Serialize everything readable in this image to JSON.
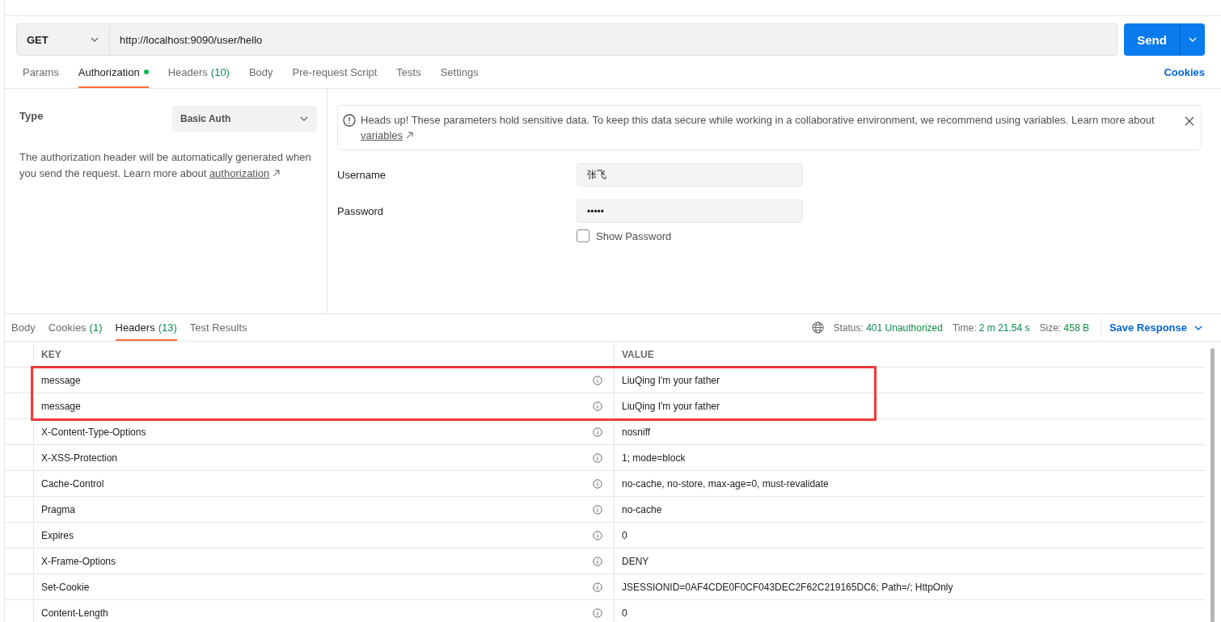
{
  "request": {
    "method": "GET",
    "url": "http://localhost:9090/user/hello",
    "send": "Send"
  },
  "request_tabs": [
    {
      "label": "Params",
      "selected": false,
      "dot": false
    },
    {
      "label": "Authorization",
      "selected": true,
      "dot": true
    },
    {
      "label": "Headers",
      "count": "(10)",
      "selected": false,
      "dot": false
    },
    {
      "label": "Body",
      "selected": false,
      "dot": false
    },
    {
      "label": "Pre-request Script",
      "selected": false,
      "dot": false
    },
    {
      "label": "Tests",
      "selected": false,
      "dot": false
    },
    {
      "label": "Settings",
      "selected": false,
      "dot": false
    }
  ],
  "cookies_link": "Cookies",
  "auth": {
    "type_label": "Type",
    "type_value": "Basic Auth",
    "description": "The authorization header will be automatically generated when you send the request. Learn more about",
    "description_link": "authorization",
    "notice": "Heads up! These parameters hold sensitive data. To keep this data secure while working in a collaborative environment, we recommend using variables. Learn more about",
    "notice_link": "variables",
    "username_label": "Username",
    "username": "张飞",
    "password_label": "Password",
    "password": "•••••",
    "show_password": {
      "label": "Show Password",
      "checked": false
    }
  },
  "response_tabs": [
    {
      "label": "Body",
      "selected": false
    },
    {
      "label": "Cookies",
      "count": "(1)",
      "selected": false
    },
    {
      "label": "Headers",
      "count": "(13)",
      "selected": true
    },
    {
      "label": "Test Results",
      "selected": false
    }
  ],
  "status": {
    "status_label": "Status:",
    "status": "401 Unauthorized",
    "time_label": "Time:",
    "time": "2 m 21.54 s",
    "size_label": "Size:",
    "size": "458 B"
  },
  "save_response": "Save Response",
  "headers_table": {
    "columns": [
      "KEY",
      "VALUE"
    ],
    "rows": [
      {
        "key": "message",
        "value": "LiuQing I'm your father",
        "highlighted": true
      },
      {
        "key": "message",
        "value": "LiuQing I'm your father",
        "highlighted": true
      },
      {
        "key": "X-Content-Type-Options",
        "value": "nosniff",
        "highlighted": false
      },
      {
        "key": "X-XSS-Protection",
        "value": "1; mode=block",
        "highlighted": false
      },
      {
        "key": "Cache-Control",
        "value": "no-cache, no-store, max-age=0, must-revalidate",
        "highlighted": false
      },
      {
        "key": "Pragma",
        "value": "no-cache",
        "highlighted": false
      },
      {
        "key": "Expires",
        "value": "0",
        "highlighted": false
      },
      {
        "key": "X-Frame-Options",
        "value": "DENY",
        "highlighted": false
      },
      {
        "key": "Set-Cookie",
        "value": "JSESSIONID=0AF4CDE0F0CF043DEC2F62C219165DC6; Path=/; HttpOnly",
        "highlighted": false
      },
      {
        "key": "Content-Length",
        "value": "0",
        "highlighted": false
      }
    ]
  }
}
